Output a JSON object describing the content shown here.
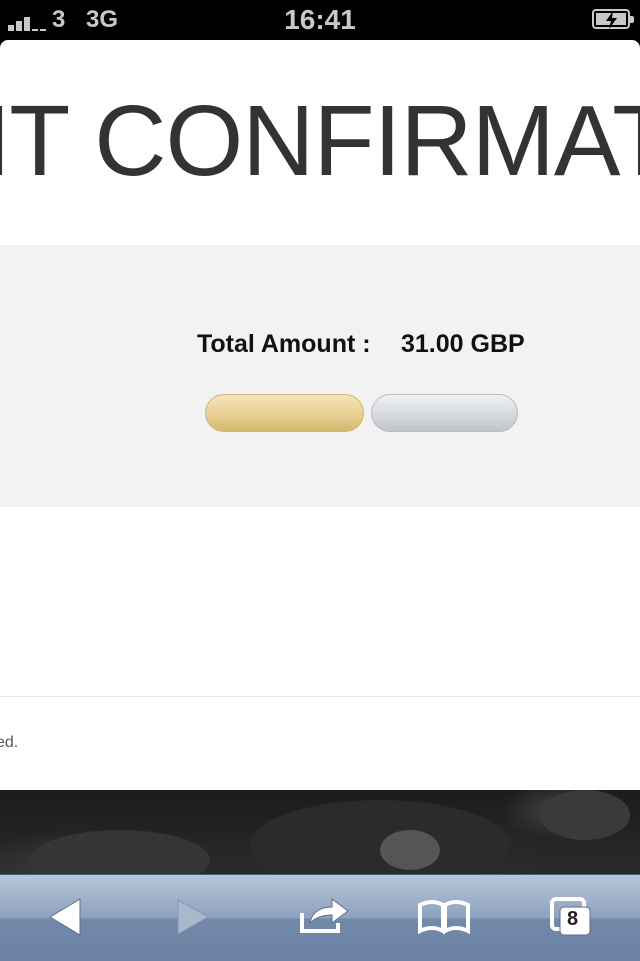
{
  "status_bar": {
    "carrier": "3",
    "network": "3G",
    "time": "16:41"
  },
  "page": {
    "title": "NT CONFIRMAT",
    "total_label": "Total Amount :",
    "total_value": "31.00 GBP",
    "buttons": [
      {
        "name": "confirm",
        "label": "",
        "color": "#e6cf92"
      },
      {
        "name": "cancel",
        "label": "",
        "color": "#d5d8dc"
      }
    ],
    "footer_text": "ed."
  },
  "toolbar": {
    "items": [
      {
        "icon": "back-arrow-icon"
      },
      {
        "icon": "forward-arrow-icon"
      },
      {
        "icon": "share-icon"
      },
      {
        "icon": "bookmarks-icon"
      },
      {
        "icon": "tabs-icon",
        "badge": "8"
      }
    ]
  },
  "colors": {
    "toolbar": "#8da2bf",
    "panel": "#f2f2f2",
    "title": "#333333"
  }
}
